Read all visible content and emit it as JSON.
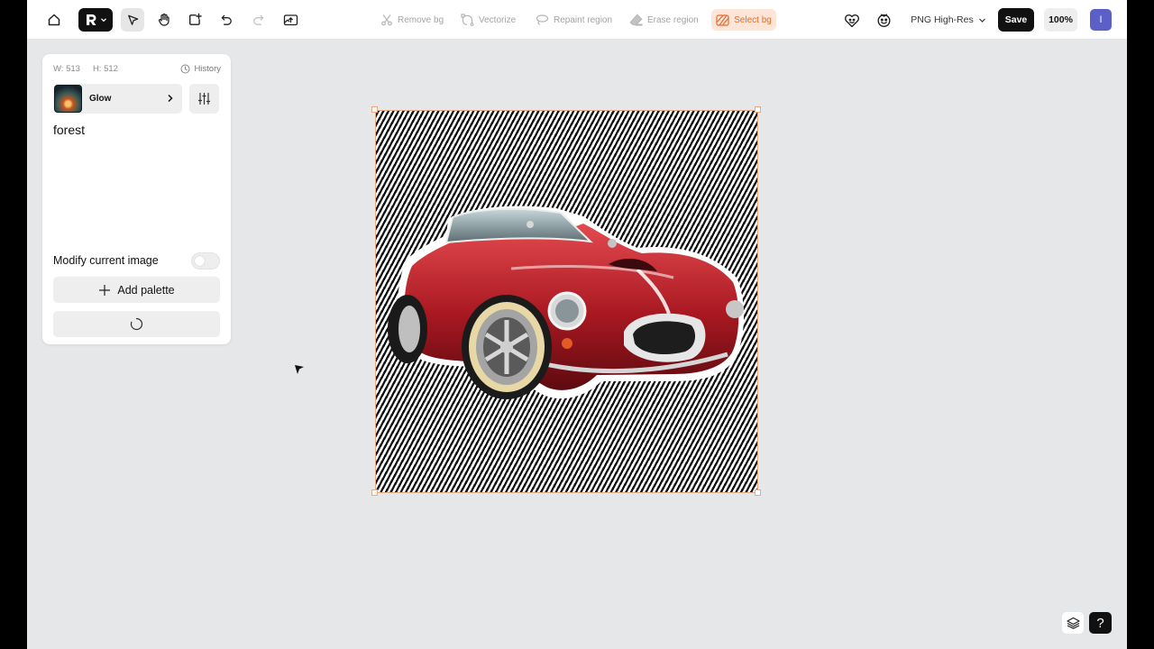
{
  "toolbar": {
    "tools": [
      {
        "name": "home",
        "icon": "home-icon"
      },
      {
        "name": "model",
        "icon": "model-logo-icon"
      },
      {
        "name": "select",
        "icon": "pointer-icon"
      },
      {
        "name": "pan",
        "icon": "hand-icon"
      },
      {
        "name": "add-frame",
        "icon": "frame-plus-icon"
      },
      {
        "name": "undo",
        "icon": "undo-icon"
      },
      {
        "name": "redo",
        "icon": "redo-icon"
      },
      {
        "name": "upload",
        "icon": "upload-image-icon"
      }
    ],
    "actions": {
      "remove_bg": "Remove bg",
      "vectorize": "Vectorize",
      "repaint_region": "Repaint region",
      "erase_region": "Erase region",
      "select_bg": "Select bg"
    },
    "export_format": "PNG High-Res",
    "save_label": "Save",
    "zoom_label": "100%",
    "avatar_initial": "I"
  },
  "panel": {
    "width_label": "W: 513",
    "height_label": "H: 512",
    "history_label": "History",
    "style_name": "Glow",
    "prompt_text": "forest",
    "modify_label": "Modify current image",
    "modify_enabled": false,
    "add_palette_label": "Add palette"
  },
  "colors": {
    "accent": "#e96a2c",
    "accent_bg": "#fde6d8",
    "avatar": "#5b5fc7",
    "canvas_bg": "#e5e7e8",
    "selection": "#e9a983"
  }
}
